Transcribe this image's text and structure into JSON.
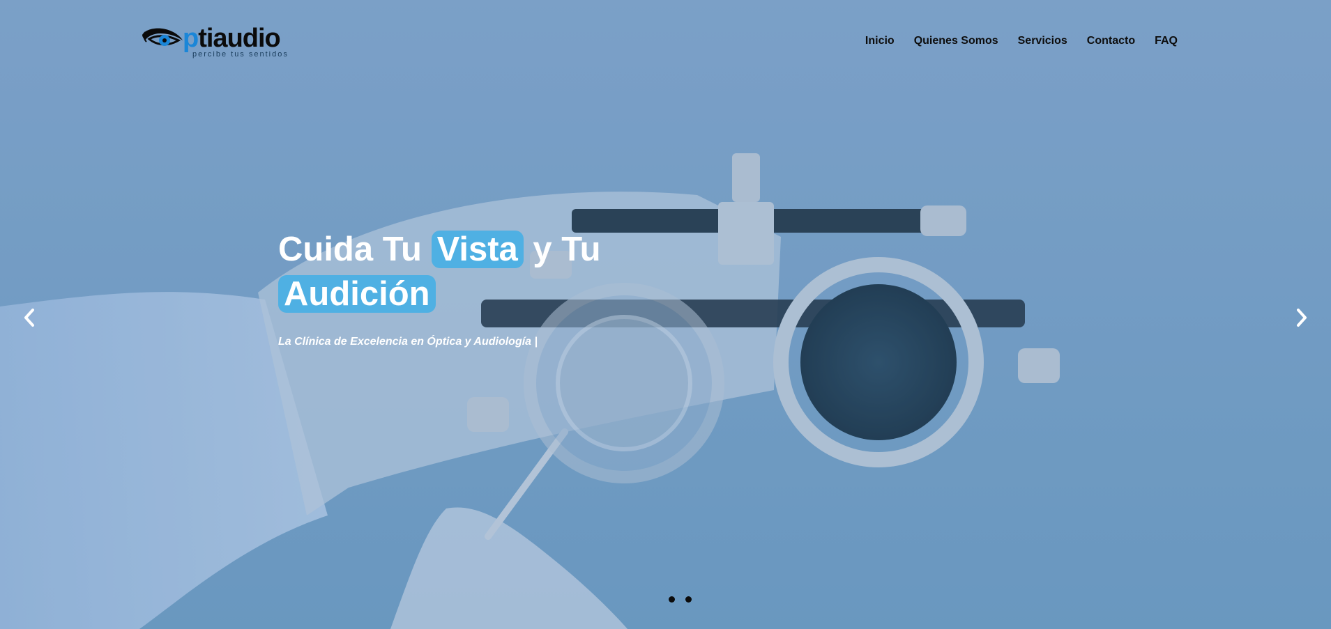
{
  "logo": {
    "wordmark_p": "p",
    "wordmark_rest": "tiaudio",
    "tagline": "percibe tus sentidos"
  },
  "nav": {
    "items": [
      {
        "label": "Inicio"
      },
      {
        "label": "Quienes Somos"
      },
      {
        "label": "Servicios"
      },
      {
        "label": "Contacto"
      },
      {
        "label": "FAQ"
      }
    ]
  },
  "hero": {
    "headline_part1": "Cuida Tu ",
    "headline_highlight1": "Vista",
    "headline_part2": " y Tu ",
    "headline_highlight2": "Audición",
    "subheadline": "La Clínica de Excelencia en Óptica y Audiología |"
  },
  "carousel": {
    "prev_icon": "chevron-left-icon",
    "next_icon": "chevron-right-icon",
    "slides": 2
  },
  "colors": {
    "accent": "#4fb0e3",
    "brand_blue": "#1a86d8",
    "text_dark": "#0d0d0d",
    "hero_tint": "#7fa3c7"
  }
}
